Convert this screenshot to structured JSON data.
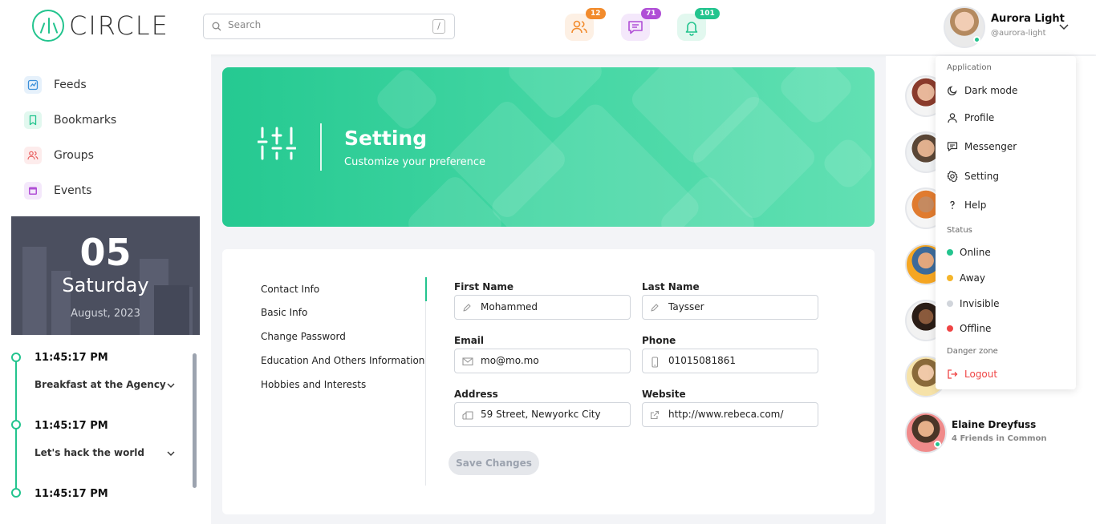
{
  "header": {
    "logo_text": "CIRCLE",
    "search_placeholder": "Search",
    "search_shortcut": "/",
    "friend_requests_badge": "12",
    "messages_badge": "71",
    "notifications_badge": "101",
    "user_name": "Aurora Light",
    "user_handle": "@aurora-light"
  },
  "sidebar": {
    "items": [
      {
        "label": "Feeds",
        "icon": "feeds-icon"
      },
      {
        "label": "Bookmarks",
        "icon": "bookmark-icon"
      },
      {
        "label": "Groups",
        "icon": "groups-icon"
      },
      {
        "label": "Events",
        "icon": "calendar-icon"
      }
    ],
    "date_card": {
      "day": "05",
      "weekday": "Saturday",
      "month_year": "August, 2023"
    },
    "timeline": [
      {
        "time": "11:45:17 PM",
        "title": "Breakfast at the Agency"
      },
      {
        "time": "11:45:17 PM",
        "title": "Let's hack the world"
      },
      {
        "time": "11:45:17 PM"
      }
    ]
  },
  "banner": {
    "title": "Setting",
    "subtitle": "Customize your preference"
  },
  "settings": {
    "tabs": [
      "Contact Info",
      "Basic Info",
      "Change Password",
      "Education And Others Information",
      "Hobbies and Interests"
    ],
    "fields": {
      "first_name": {
        "label": "First Name",
        "value": "Mohammed"
      },
      "last_name": {
        "label": "Last Name",
        "value": "Taysser"
      },
      "email": {
        "label": "Email",
        "value": "mo@mo.mo"
      },
      "phone": {
        "label": "Phone",
        "value": "01015081861"
      },
      "address": {
        "label": "Address",
        "value": "59 Street, Newyorkc City"
      },
      "website": {
        "label": "Website",
        "value": "http://www.rebeca.com/"
      }
    },
    "save_label": "Save Changes"
  },
  "friend": {
    "name": "Elaine Dreyfuss",
    "common": "4 Friends in Common"
  },
  "dropdown": {
    "application_label": "Application",
    "items": [
      "Dark mode",
      "Profile",
      "Messenger",
      "Setting",
      "Help"
    ],
    "status_label": "Status",
    "statuses": [
      {
        "label": "Online",
        "color": "#23c48e"
      },
      {
        "label": "Away",
        "color": "#f5b52a"
      },
      {
        "label": "Invisible",
        "color": "#d1d5db"
      },
      {
        "label": "Offline",
        "color": "#ef4444"
      }
    ],
    "danger_label": "Danger zone",
    "logout_label": "Logout"
  },
  "colors": {
    "accent": "#23c48e",
    "danger": "#ef4444"
  }
}
